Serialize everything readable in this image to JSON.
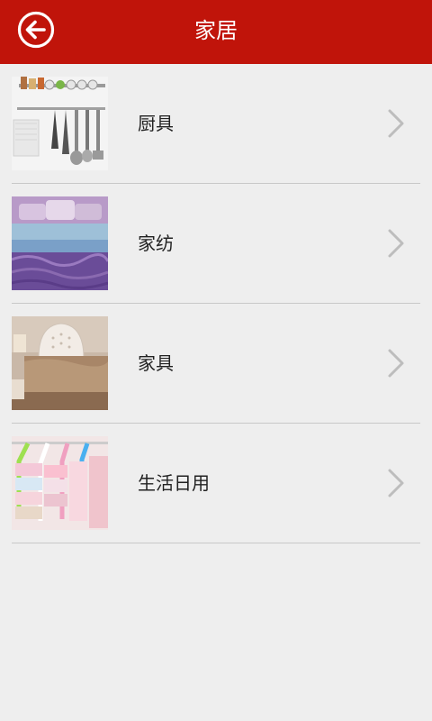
{
  "header": {
    "title": "家居",
    "back_icon": "back-arrow-circle-icon"
  },
  "categories": [
    {
      "label": "厨具",
      "image": "kitchen-utensils-rack"
    },
    {
      "label": "家纺",
      "image": "purple-bedding-set"
    },
    {
      "label": "家具",
      "image": "european-bed"
    },
    {
      "label": "生活日用",
      "image": "colorful-clothes-hangers"
    }
  ],
  "colors": {
    "header_bg": "#c0140a",
    "page_bg": "#eeeeee",
    "chevron": "#bdbdbd"
  }
}
